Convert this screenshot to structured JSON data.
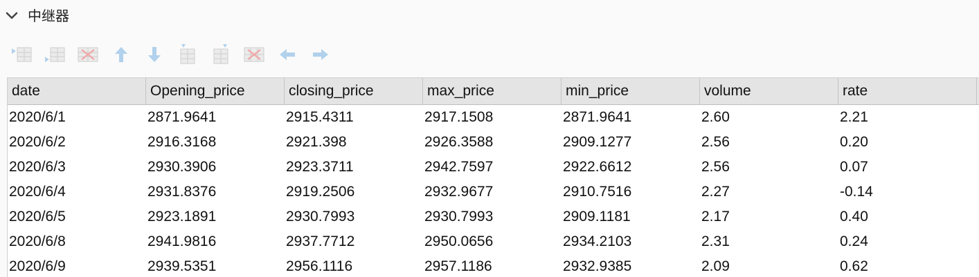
{
  "panel": {
    "title": "中继器",
    "expanded": true
  },
  "toolbar": {
    "buttons": [
      {
        "name": "insert-row-above",
        "icon": "insert-row-above-icon"
      },
      {
        "name": "insert-row-below",
        "icon": "insert-row-below-icon"
      },
      {
        "name": "delete-row",
        "icon": "delete-row-icon"
      },
      {
        "name": "move-up",
        "icon": "arrow-up-icon"
      },
      {
        "name": "move-down",
        "icon": "arrow-down-icon"
      },
      {
        "name": "insert-column-left",
        "icon": "insert-column-left-icon"
      },
      {
        "name": "insert-column-right",
        "icon": "insert-column-right-icon"
      },
      {
        "name": "delete-column",
        "icon": "delete-column-icon"
      },
      {
        "name": "move-left",
        "icon": "arrow-left-icon"
      },
      {
        "name": "move-right",
        "icon": "arrow-right-icon"
      }
    ],
    "disabled_color": "#9ec6e8"
  },
  "table": {
    "columns": [
      "date",
      "Opening_price",
      "closing_price",
      "max_price",
      "min_price",
      "volume",
      "rate"
    ],
    "rows": [
      [
        "2020/6/1",
        "2871.9641",
        "2915.4311",
        "2917.1508",
        "2871.9641",
        "2.60",
        "2.21"
      ],
      [
        "2020/6/2",
        "2916.3168",
        "2921.398",
        "2926.3588",
        "2909.1277",
        "2.56",
        "0.20"
      ],
      [
        "2020/6/3",
        "2930.3906",
        "2923.3711",
        "2942.7597",
        "2922.6612",
        "2.56",
        "0.07"
      ],
      [
        "2020/6/4",
        "2931.8376",
        "2919.2506",
        "2932.9677",
        "2910.7516",
        "2.27",
        "-0.14"
      ],
      [
        "2020/6/5",
        "2923.1891",
        "2930.7993",
        "2930.7993",
        "2909.1181",
        "2.17",
        "0.40"
      ],
      [
        "2020/6/8",
        "2941.9816",
        "2937.7712",
        "2950.0656",
        "2934.2103",
        "2.31",
        "0.24"
      ],
      [
        "2020/6/9",
        "2939.5351",
        "2956.1116",
        "2957.1186",
        "2932.9385",
        "2.09",
        "0.62"
      ]
    ],
    "header_bg": "#e4e4e4"
  }
}
